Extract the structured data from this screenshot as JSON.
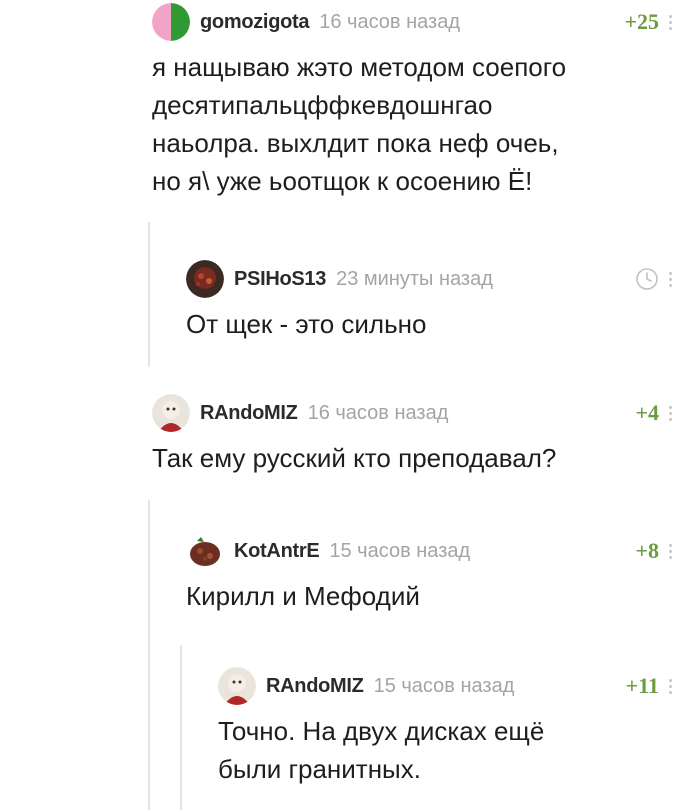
{
  "comments": [
    {
      "username": "gomozigota",
      "time": "16 часов назад",
      "rating": "+25",
      "text": "я нащываю жэто методом соепого\nдесятипальцффкевдошнгао\nнаьолра. выхлдит пока неф очеь,\nно я\\ уже ьоотщок к осоению Ё!"
    },
    {
      "username": "PSIHoS13",
      "time": "23 минуты назад",
      "rating": "",
      "text": "От щек - это сильно"
    },
    {
      "username": "RAndoMIZ",
      "time": "16 часов назад",
      "rating": "+4",
      "text": "Так ему русский кто преподавал?"
    },
    {
      "username": "KotAntrE",
      "time": "15 часов назад",
      "rating": "+8",
      "text": "Кирилл и Мефодий"
    },
    {
      "username": "RAndoMIZ",
      "time": "15 часов назад",
      "rating": "+11",
      "text": "Точно. На двух дисках ещё\nбыли гранитных."
    }
  ],
  "colors": {
    "rating": "#6d9b42",
    "meta": "#a4a4a4",
    "thread_line": "#e4e4e4"
  },
  "icons": [
    "clock-icon",
    "more-options-icon"
  ]
}
